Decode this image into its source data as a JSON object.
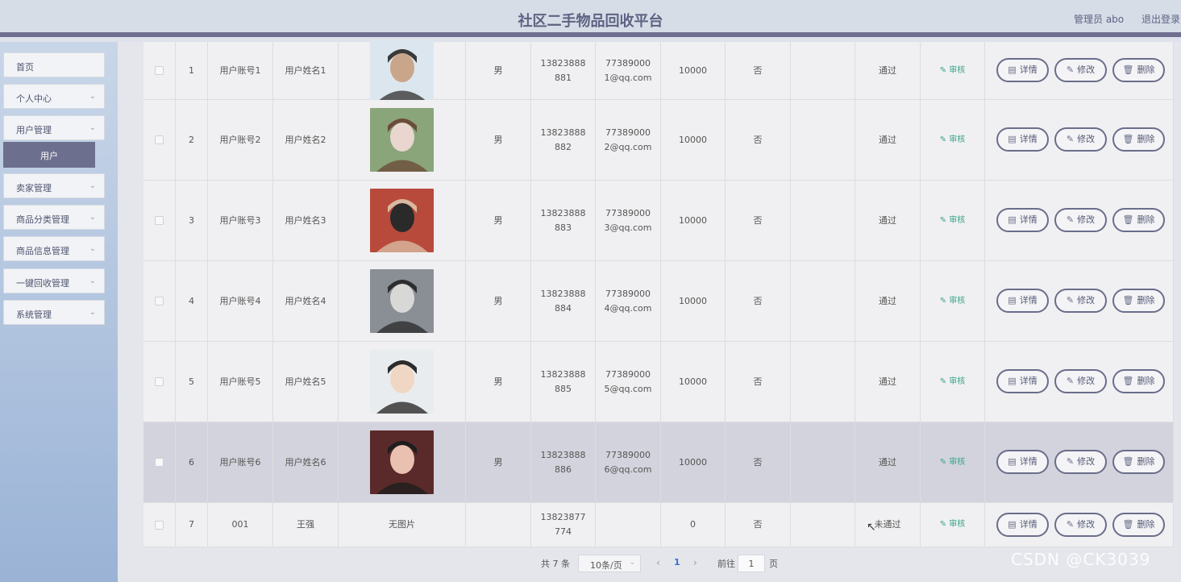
{
  "header": {
    "title": "社区二手物品回收平台",
    "admin_label": "管理员 abo",
    "logout_label": "退出登录"
  },
  "sidebar": {
    "items": [
      {
        "label": "首页",
        "has_chevron": false
      },
      {
        "label": "个人中心",
        "has_chevron": true
      },
      {
        "label": "用户管理",
        "has_chevron": true
      },
      {
        "label": "卖家管理",
        "has_chevron": true
      },
      {
        "label": "商品分类管理",
        "has_chevron": true
      },
      {
        "label": "商品信息管理",
        "has_chevron": true
      },
      {
        "label": "一键回收管理",
        "has_chevron": true
      },
      {
        "label": "系统管理",
        "has_chevron": true
      }
    ],
    "active_sub": "用户"
  },
  "table": {
    "rows": [
      {
        "index": "1",
        "account": "用户账号1",
        "name": "用户姓名1",
        "photo": "avatar-1",
        "gender": "男",
        "phone": "13823888881",
        "email": "773890001@qq.com",
        "balance": "10000",
        "flag": "否",
        "status": "通过"
      },
      {
        "index": "2",
        "account": "用户账号2",
        "name": "用户姓名2",
        "photo": "avatar-2",
        "gender": "男",
        "phone": "13823888882",
        "email": "773890002@qq.com",
        "balance": "10000",
        "flag": "否",
        "status": "通过"
      },
      {
        "index": "3",
        "account": "用户账号3",
        "name": "用户姓名3",
        "photo": "avatar-3",
        "gender": "男",
        "phone": "13823888883",
        "email": "773890003@qq.com",
        "balance": "10000",
        "flag": "否",
        "status": "通过"
      },
      {
        "index": "4",
        "account": "用户账号4",
        "name": "用户姓名4",
        "photo": "avatar-4",
        "gender": "男",
        "phone": "13823888884",
        "email": "773890004@qq.com",
        "balance": "10000",
        "flag": "否",
        "status": "通过"
      },
      {
        "index": "5",
        "account": "用户账号5",
        "name": "用户姓名5",
        "photo": "avatar-5",
        "gender": "男",
        "phone": "13823888885",
        "email": "773890005@qq.com",
        "balance": "10000",
        "flag": "否",
        "status": "通过"
      },
      {
        "index": "6",
        "account": "用户账号6",
        "name": "用户姓名6",
        "photo": "avatar-6",
        "gender": "男",
        "phone": "13823888886",
        "email": "773890006@qq.com",
        "balance": "10000",
        "flag": "否",
        "status": "通过"
      },
      {
        "index": "7",
        "account": "001",
        "name": "王强",
        "photo_text": "无图片",
        "gender": "",
        "phone": "13823877774",
        "email": "",
        "balance": "0",
        "flag": "否",
        "status": "未通过"
      }
    ],
    "audit_label": "审核",
    "detail_label": "详情",
    "edit_label": "修改",
    "delete_label": "删除"
  },
  "pager": {
    "total": "共 7 条",
    "page_size": "10条/页",
    "current_page": "1",
    "goto_label": "前往",
    "goto_value": "1",
    "page_label": "页"
  },
  "watermark": "CSDN @CK3039",
  "colors": {
    "accent": "#6f7091",
    "audit": "#3aa58a",
    "page_active": "#3b6fd1"
  }
}
